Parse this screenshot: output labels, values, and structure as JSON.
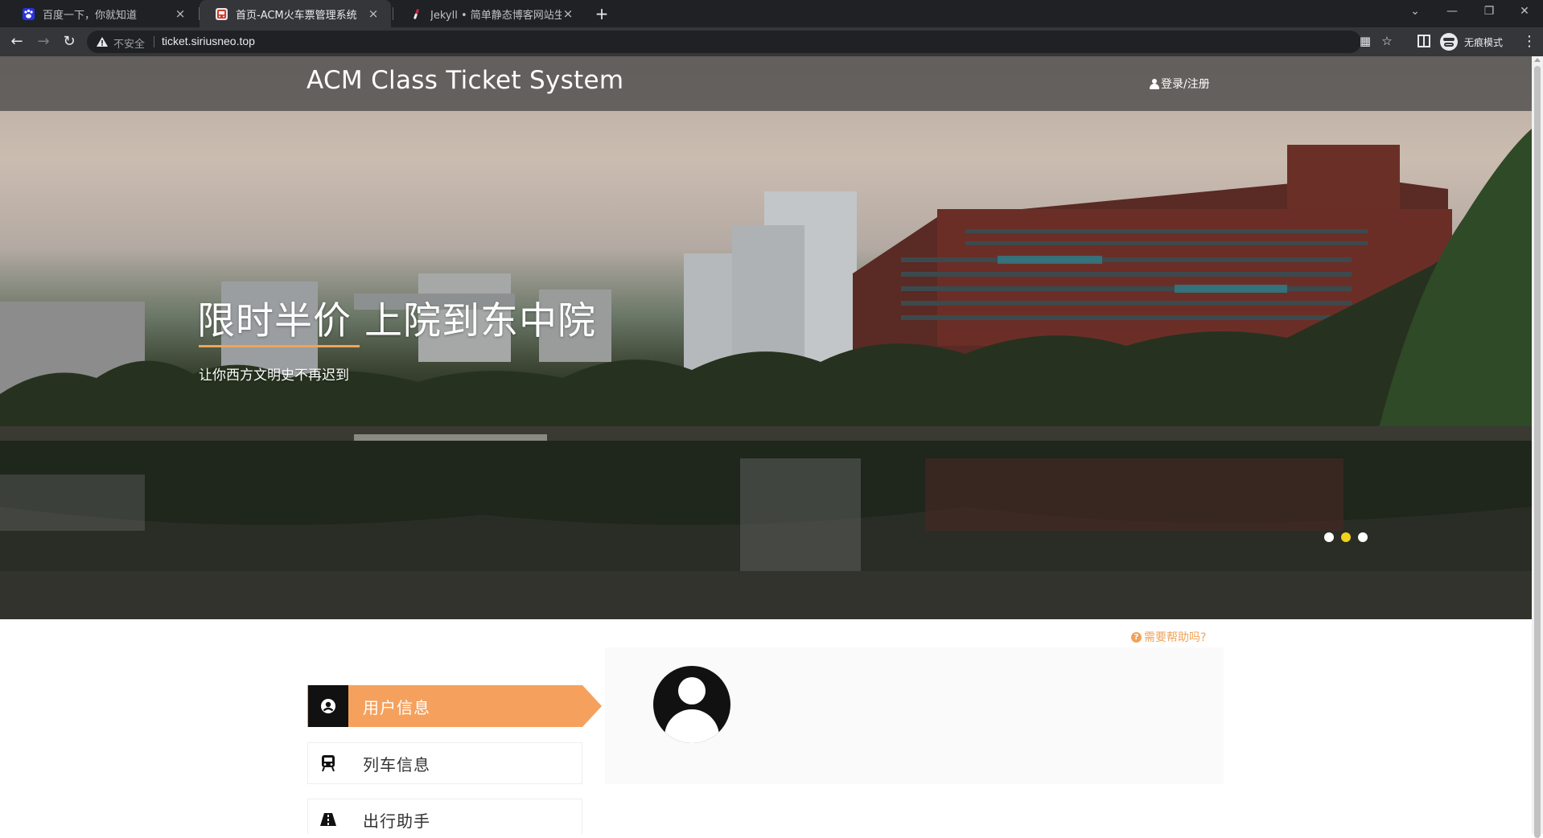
{
  "browser": {
    "tabs": [
      {
        "title": "百度一下，你就知道",
        "favicon": "baidu-paw-icon",
        "active": false
      },
      {
        "title": "首页-ACM火车票管理系统",
        "favicon": "train-logo-icon",
        "active": true
      },
      {
        "title": "Jekyll • 简单静态博客网站生成器",
        "favicon": "jekyll-tube-icon",
        "active": false
      }
    ],
    "new_tab": "+",
    "security_label": "不安全",
    "url": "ticket.siriusneo.top",
    "incognito_label": "无痕模式"
  },
  "site": {
    "brand": "ACM Class Ticket System",
    "login_label": "登录/注册"
  },
  "carousel": {
    "title": "限时半价 上院到东中院",
    "subtitle": "让你西方文明史不再迟到",
    "slide_count": 3,
    "active_slide": 2
  },
  "sidebar": {
    "items": [
      {
        "label": "用户信息",
        "icon": "user-circle-icon",
        "active": true
      },
      {
        "label": "列车信息",
        "icon": "train-icon",
        "active": false
      },
      {
        "label": "出行助手",
        "icon": "road-icon",
        "active": false
      }
    ]
  },
  "help_label": "需要帮助吗?",
  "colors": {
    "accent": "#f5a15d",
    "active_dot": "#f3d21a",
    "header_overlay": "#464646"
  }
}
